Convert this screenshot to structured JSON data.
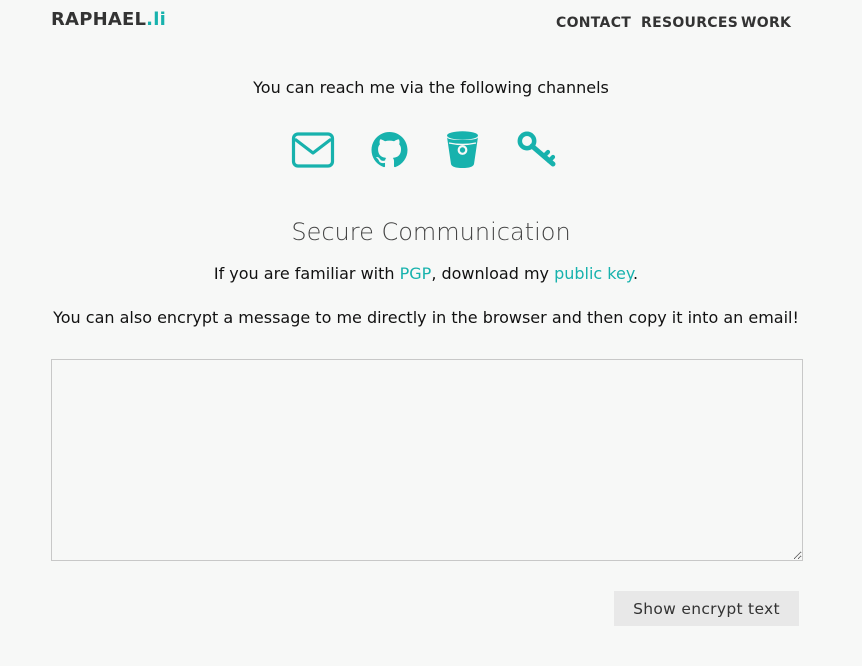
{
  "header": {
    "brand_main": "RAPHAEL",
    "brand_accent": ".li",
    "nav": [
      {
        "label": "CONTACT"
      },
      {
        "label": "RESOURCES"
      },
      {
        "label": "WORK"
      }
    ]
  },
  "contact": {
    "intro": "You can reach me via the following channels",
    "icons": [
      "envelope-icon",
      "github-icon",
      "bitbucket-icon",
      "key-icon"
    ]
  },
  "secure": {
    "heading": "Secure Communication",
    "pgp_prefix": "If you are familiar with ",
    "pgp_link": "PGP",
    "pgp_middle": ", download my ",
    "key_link": "public key",
    "pgp_suffix": ".",
    "encrypt_text": "You can also encrypt a message to me directly in the browser and then copy it into an email!",
    "message_value": "",
    "button_label": "Show encrypt text"
  },
  "colors": {
    "accent": "#17b2ad",
    "background": "#f7f8f7",
    "button_bg": "#e8e8e8"
  }
}
